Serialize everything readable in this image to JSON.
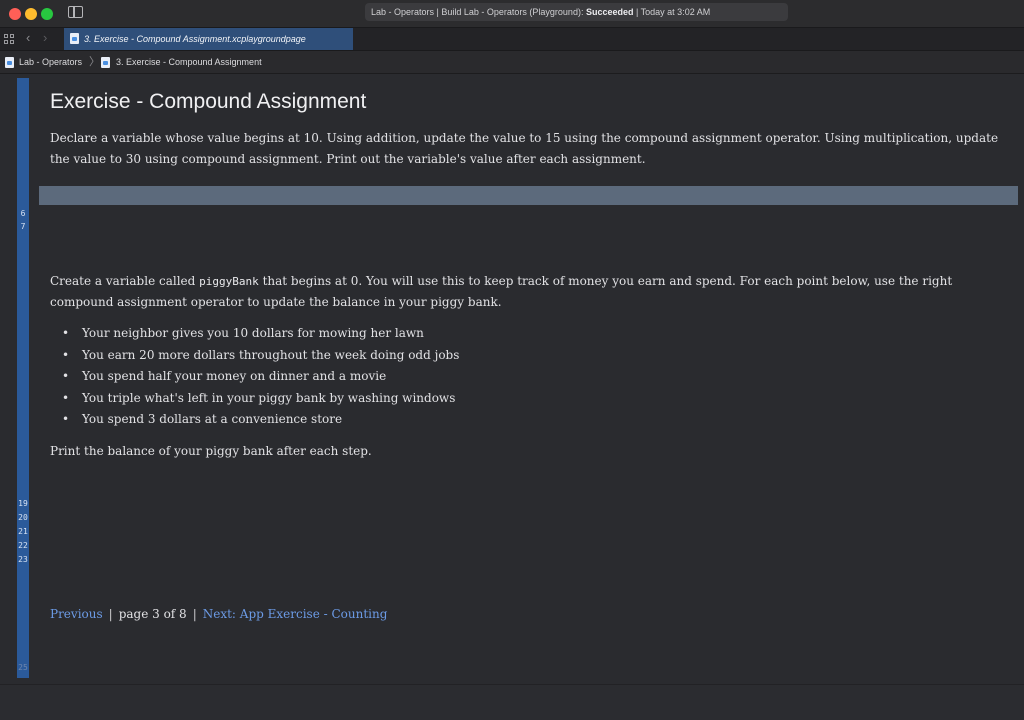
{
  "window": {
    "status_prefix": "Lab - Operators | Build Lab - Operators (Playground): ",
    "status_result": "Succeeded",
    "status_suffix": " | Today at 3:02 AM"
  },
  "tabs": [
    {
      "label": "3. Exercise - Compound Assignment.xcplaygroundpage",
      "active": true
    }
  ],
  "breadcrumb": {
    "items": [
      "Lab - Operators",
      "3. Exercise - Compound Assignment"
    ],
    "separator": "〉"
  },
  "gutter": {
    "lines_top": [
      "6",
      "7"
    ],
    "lines_bottom": [
      "19",
      "20",
      "21",
      "22",
      "23"
    ],
    "line_last": "25"
  },
  "page": {
    "title": "Exercise - Compound Assignment",
    "intro": "Declare a variable whose value begins at 10. Using addition, update the value to 15 using the compound assignment operator. Using multiplication, update the value to 30 using compound assignment. Print out the variable's value after each assignment.",
    "p2_before": "Create a variable called ",
    "p2_code": "piggyBank",
    "p2_after": " that begins at 0. You will use this to keep track of money you earn and spend. For each point below, use the right compound assignment operator to update the balance in your piggy bank.",
    "bullet_glyph": "•",
    "bullets": [
      "Your neighbor gives you 10 dollars for mowing her lawn",
      "You earn 20 more dollars throughout the week doing odd jobs",
      "You spend half your money on dinner and a movie",
      "You triple what's left in your piggy bank by washing windows",
      "You spend 3 dollars at a convenience store"
    ],
    "closing": "Print the balance of your piggy bank after each step."
  },
  "footer_nav": {
    "previous": "Previous",
    "separator": "|",
    "page_info": "page 3 of 8",
    "next": "Next: App Exercise - Counting"
  },
  "colors": {
    "accent": "#2b5a9a",
    "link": "#6c9be6",
    "tab_active": "#2f4f7a"
  }
}
